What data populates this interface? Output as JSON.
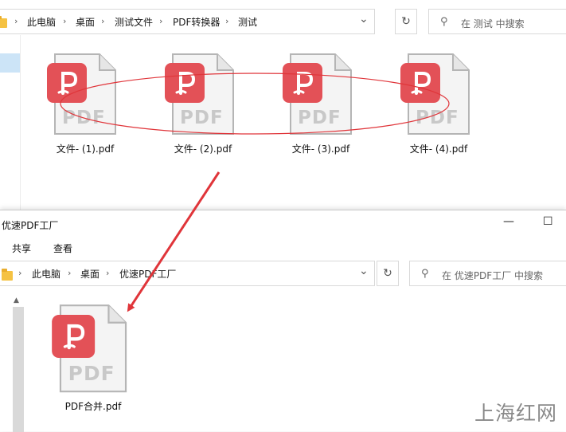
{
  "top_window": {
    "breadcrumb": [
      "此电脑",
      "桌面",
      "测试文件",
      "PDF转换器",
      "测试"
    ],
    "search_placeholder": "在 测试 中搜索",
    "files": [
      "文件- (1).pdf",
      "文件- (2).pdf",
      "文件- (3).pdf",
      "文件- (4).pdf"
    ]
  },
  "bottom_window": {
    "title": "优速PDF工厂",
    "minimize_glyph": "—",
    "maximize_glyph": "☐",
    "ribbon_tabs": [
      "共享",
      "查看"
    ],
    "breadcrumb": [
      "此电脑",
      "桌面",
      "优速PDF工厂"
    ],
    "search_placeholder": "在 优速PDF工厂 中搜索",
    "files": [
      "PDF合并.pdf"
    ]
  },
  "icons": {
    "chevron": "›",
    "dropdown": "⌄",
    "refresh": "↻",
    "search": "⚲",
    "scroll_up": "▲"
  },
  "file_icon_label": "PDF",
  "watermark": "上海红网",
  "colors": {
    "badge": "#e35157",
    "annotation": "#e0353a",
    "selection": "#cce4f7"
  }
}
